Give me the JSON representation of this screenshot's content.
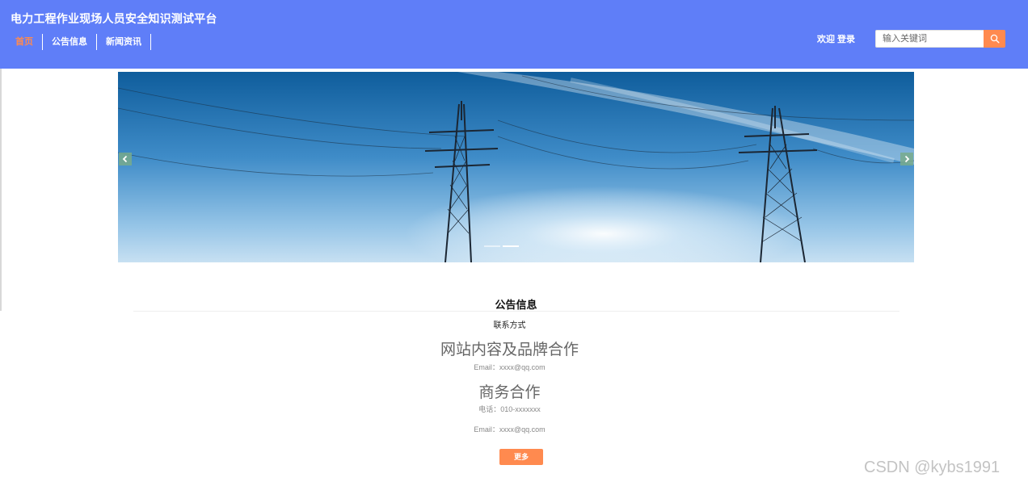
{
  "header": {
    "site_title": "电力工程作业现场人员安全知识测试平台",
    "nav": [
      {
        "label": "首页",
        "active": true
      },
      {
        "label": "公告信息",
        "active": false
      },
      {
        "label": "新闻资讯",
        "active": false
      }
    ],
    "welcome": "欢迎 登录",
    "search": {
      "placeholder": "输入关键词",
      "value": ""
    }
  },
  "banner": {
    "slide_count": 2,
    "active_slide": 2
  },
  "notice": {
    "section_title": "公告信息",
    "contact_title": "联系方式",
    "heading1": "网站内容及品牌合作",
    "email1": "Email：xxxx@qq.com",
    "heading2": "商务合作",
    "phone": "电话：010-xxxxxxx",
    "email2": "Email：xxxx@qq.com",
    "more_label": "更多"
  },
  "watermark": "CSDN @kybs1991",
  "colors": {
    "header_bg": "#5f7ef8",
    "accent": "#ff8a4f",
    "active_nav": "#ff8a4f"
  },
  "icons": {
    "search": "search-icon",
    "prev": "chevron-left-icon",
    "next": "chevron-right-icon"
  }
}
